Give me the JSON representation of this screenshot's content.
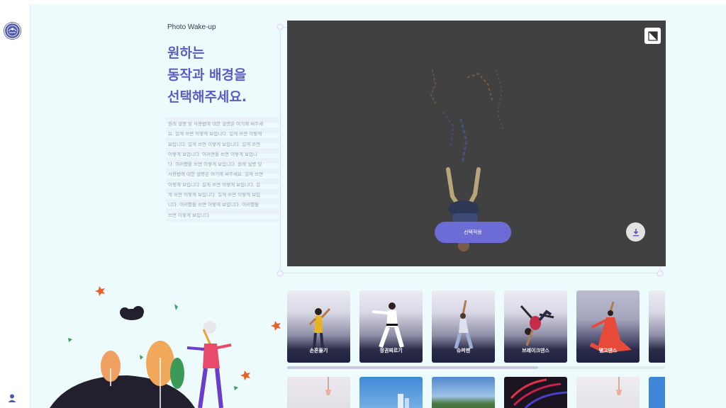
{
  "app": {
    "title": "Photo Wake-up"
  },
  "intro": {
    "headline_lines": [
      "원하는",
      "동작과 배경을",
      "선택해주세요."
    ],
    "description_lines": [
      "원래 설명 및 사용법에 대한 설명은 여기에 써주세",
      "요. 길게 쓰면 이렇게 보입니다. 길게 쓰면 이렇게",
      "보입니다. 길게 쓰면 이렇게 보입니다. 길게 쓰면",
      "이렇게 보입니다. 이러면을 쓰면 이렇게 보입니",
      "다. 이러했을 쓰면 이렇게 보입니다. 원래 설명 및",
      "사용법에 대한 설명은 여기에 써주세요. 길게 쓰면",
      "이렇게 보입니다. 길게 쓰면 이렇게 보입니다. 길",
      "게 쓰면 이렇게 보입니다. 길게 쓰면 이렇게 보입",
      "니다. 이러했을 쓰면 이렇게 보입니다. 이러했을",
      "쓰면 이렇게 보입니다."
    ]
  },
  "viewer": {
    "apply_label": "선택적용",
    "background": "#414141",
    "accent": "#6d6bd6"
  },
  "motions": [
    {
      "label": "손흔들기",
      "figure": "wave"
    },
    {
      "label": "정권찌르기",
      "figure": "taekwondo"
    },
    {
      "label": "슈퍼맨",
      "figure": "superman"
    },
    {
      "label": "브레이크댄스",
      "figure": "breakdance"
    },
    {
      "label": "탱고댄스",
      "figure": "tango"
    },
    {
      "label": "",
      "figure": "partial"
    }
  ],
  "backgrounds": [
    {
      "theme": "lamp",
      "color": "#e8e6ea"
    },
    {
      "theme": "city-sky",
      "color": "#3a7fd0"
    },
    {
      "theme": "landscape",
      "color": "#4c7fc4"
    },
    {
      "theme": "neon-lights",
      "color": "#1a1320"
    },
    {
      "theme": "lamp",
      "color": "#eceaee"
    },
    {
      "theme": "blue",
      "color": "#3e86d6"
    }
  ],
  "icons": {
    "logo": "logo-icon",
    "user": "user-icon",
    "expand": "expand-icon",
    "download": "download-icon"
  }
}
